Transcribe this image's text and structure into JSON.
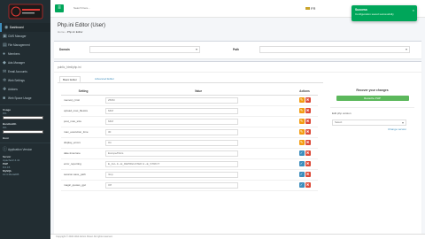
{
  "colors": {
    "sidebar_bg": "#222d32",
    "accent_green": "#00a65a",
    "edit_orange": "#f39c12",
    "delete_red": "#dd4b39",
    "save_blue": "#3c8dbc",
    "recache_green": "#5cb85c"
  },
  "sidebar": {
    "logo_text": "",
    "items": [
      {
        "icon": "dashboard-icon",
        "label": "Dashboard"
      },
      {
        "icon": "cms-icon",
        "label": "CMS Manager"
      },
      {
        "icon": "file-icon",
        "label": "File Management"
      },
      {
        "icon": "users-icon",
        "label": "Members"
      },
      {
        "icon": "ads-icon",
        "label": "Ads Manager"
      },
      {
        "icon": "email-icon",
        "label": "Email Accounts"
      },
      {
        "icon": "gear-icon",
        "label": "Web Settings"
      },
      {
        "icon": "plug-icon",
        "label": "Addons"
      },
      {
        "icon": "store-icon",
        "label": "Web Space Usage"
      }
    ],
    "info1": {
      "key": "Usage",
      "value": "0%"
    },
    "info2": {
      "key": "Bandwidth",
      "value": "0%"
    },
    "info3": {
      "key": "Host",
      "value": ""
    },
    "app_version": "Application Version",
    "server_key": "Server",
    "server_lines": [
      "Apache/2.4.41",
      "PHP",
      "8.0.15",
      "MySQL",
      "10.3 MariaDB"
    ]
  },
  "topbar": {
    "menu_icon": "hamburger-icon",
    "search_placeholder": "Search here...",
    "language": "FR",
    "user": ""
  },
  "toast": {
    "title": "Success",
    "message": "Configuration saved successfully",
    "close": "×"
  },
  "page": {
    "title": "Php.ini Editor (User)",
    "breadcrumb_home": "Home",
    "breadcrumb_current": "Php.ini Editor"
  },
  "filters": {
    "domain_label": "Domain",
    "domain_value": "",
    "path_label": "Path",
    "path_value": ""
  },
  "editor": {
    "file_path": "public_html/php.ini",
    "tab_basic": "Basic Editor",
    "tab_advanced": "Advanced Editor",
    "columns": [
      "Setting",
      "Value",
      "Actions"
    ],
    "rows": [
      {
        "key": "memory_limit",
        "value": "256M",
        "actions": [
          "edit",
          "delete"
        ]
      },
      {
        "key": "upload_max_filesize",
        "value": "64M",
        "actions": [
          "edit",
          "delete"
        ]
      },
      {
        "key": "post_max_size",
        "value": "64M",
        "actions": [
          "edit",
          "delete"
        ]
      },
      {
        "key": "max_execution_time",
        "value": "30",
        "actions": [
          "edit",
          "delete"
        ]
      },
      {
        "key": "display_errors",
        "value": "On",
        "actions": [
          "edit",
          "delete"
        ]
      },
      {
        "key": "date.timezone",
        "value": "Europe/Paris",
        "actions": [
          "save",
          "delete"
        ]
      },
      {
        "key": "error_reporting",
        "value": "E_ALL & ~E_DEPRECATED & ~E_STRICT",
        "actions": [
          "save",
          "delete"
        ]
      },
      {
        "key": "session.save_path",
        "value": "/tmp",
        "actions": [
          "save",
          "delete"
        ]
      },
      {
        "key": "magic_quotes_gpc",
        "value": "Off",
        "actions": [
          "save",
          "delete"
        ]
      }
    ]
  },
  "right_panel": {
    "title": "Recover your changes",
    "recache_button": "Recache PHP",
    "version_label": "Edit php version",
    "version_value": "Select",
    "version_link": "Change version"
  },
  "footer": {
    "text": "Copyright © 2022 Web Admin Panel. All rights reserved."
  }
}
